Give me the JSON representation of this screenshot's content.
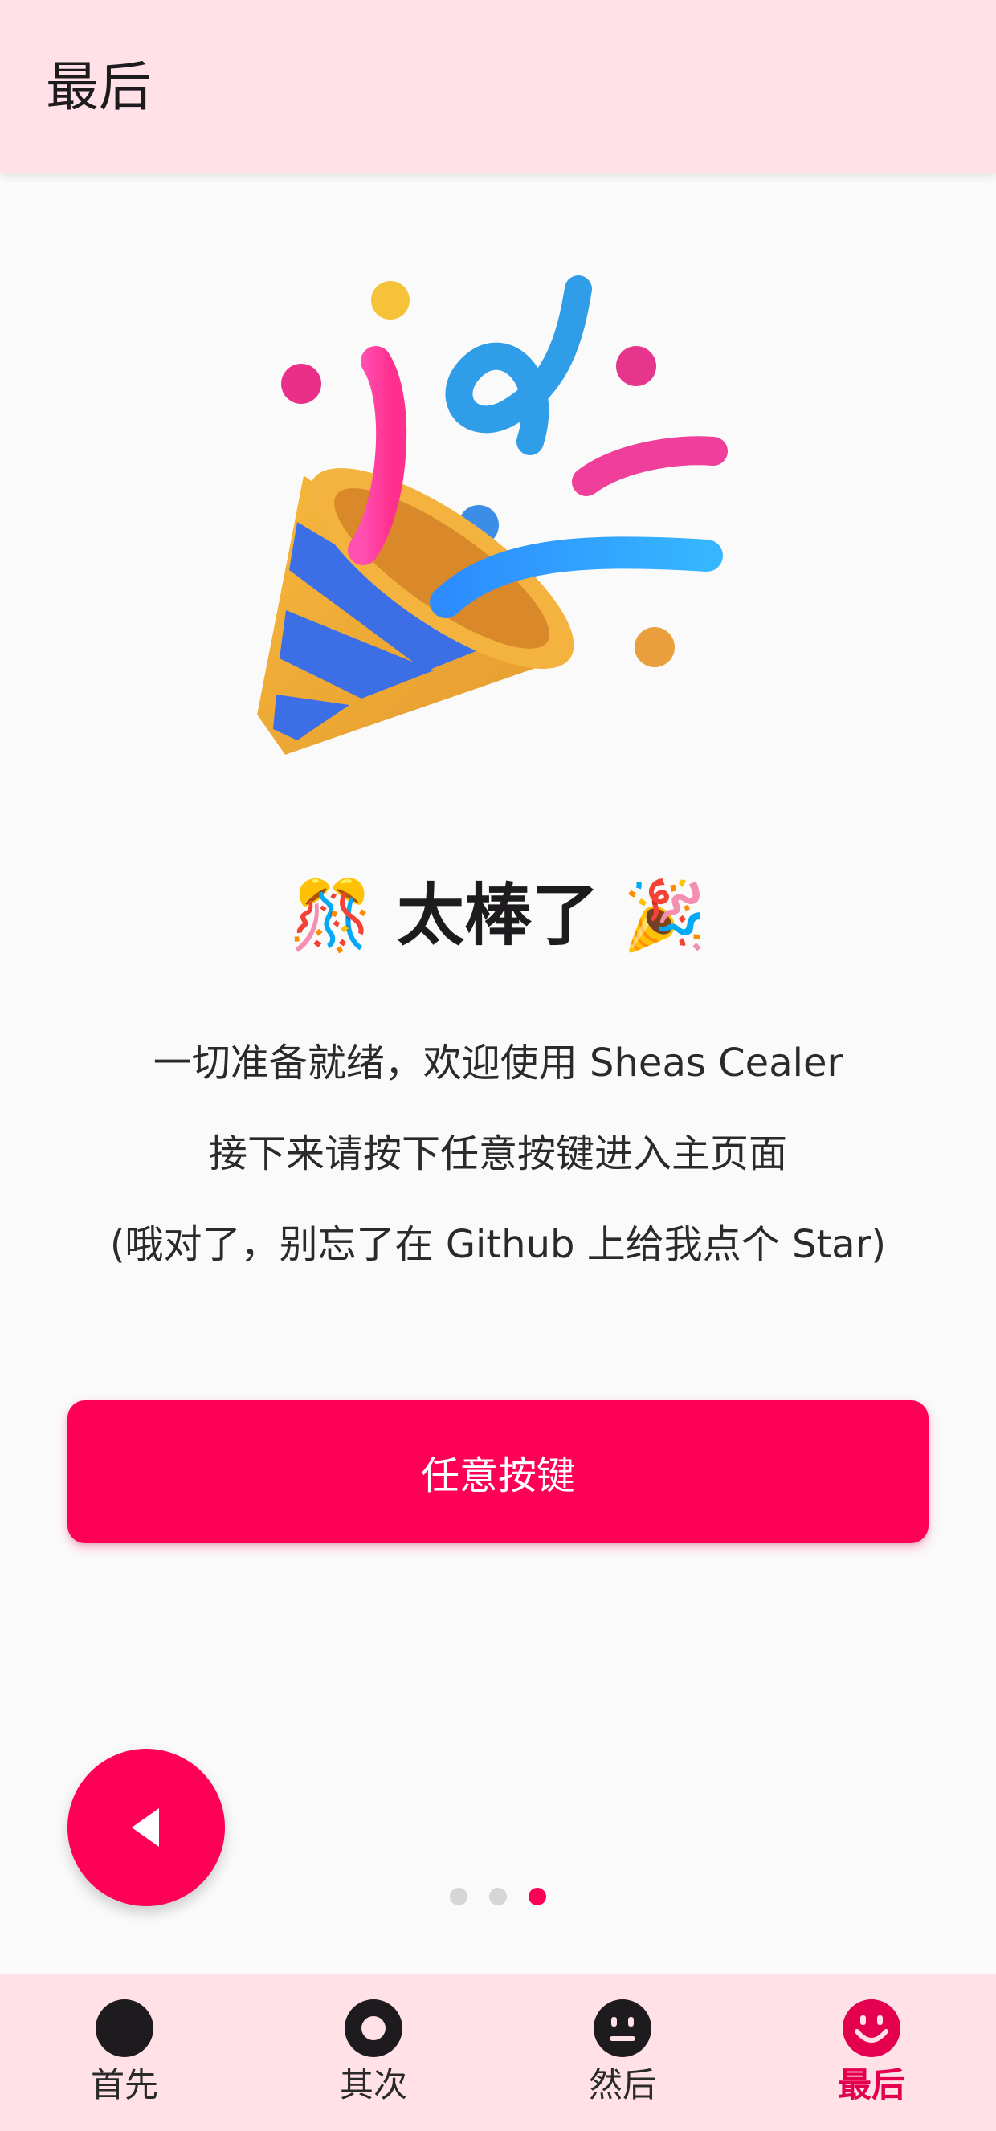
{
  "app_bar": {
    "title": "最后"
  },
  "hero": {
    "icon": "party-popper-illustration"
  },
  "headline": {
    "left_emoji": "🎊",
    "text": "太棒了",
    "right_emoji": "🎉"
  },
  "description": {
    "line1": "一切准备就绪，欢迎使用 Sheas Cealer",
    "line2": "接下来请按下任意按键进入主页面",
    "line3": "(哦对了，别忘了在 Github 上给我点个 Star)"
  },
  "primary_button": {
    "label": "任意按键"
  },
  "fab": {
    "icon": "back-triangle-icon"
  },
  "pager": {
    "count": 3,
    "active_index": 2
  },
  "bottom_nav": {
    "items": [
      {
        "label": "首先",
        "icon": "filled-circle-icon",
        "active": false
      },
      {
        "label": "其次",
        "icon": "ring-icon",
        "active": false
      },
      {
        "label": "然后",
        "icon": "neutral-face-icon",
        "active": false
      },
      {
        "label": "最后",
        "icon": "smiley-face-icon",
        "active": true
      }
    ]
  },
  "colors": {
    "accent": "#ff0057",
    "surface_tint": "#ffe1e7",
    "background": "#fafafa",
    "active_nav": "#e5004f"
  }
}
